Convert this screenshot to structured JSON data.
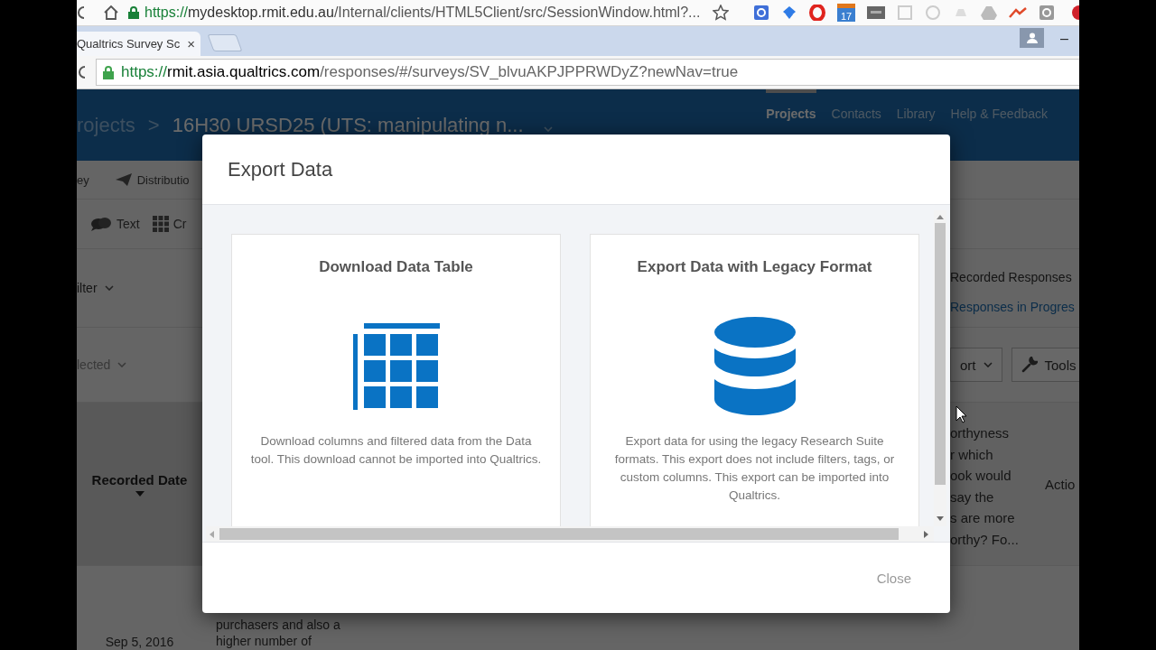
{
  "outer_browser": {
    "url_scheme": "https://",
    "url_host": "mydesktop.rmit.edu.au",
    "url_path": "/Internal/clients/HTML5Client/src/SessionWindow.html?...",
    "calendar_badge": "17"
  },
  "inner_browser": {
    "tab": {
      "title": "Qualtrics Survey Sc",
      "close": "×"
    },
    "minimize": "–",
    "url_scheme": "https://",
    "url_host": "rmit.asia.qualtrics.com",
    "url_path": "/responses/#/surveys/SV_blvuAKPJPPRWDyZ?newNav=true"
  },
  "header": {
    "breadcrumb_root": "rojects",
    "separator": ">",
    "project_title": "16H30 URSD25 (UTS: manipulating n...",
    "nav": [
      {
        "label": "Projects",
        "selected": true
      },
      {
        "label": "Contacts",
        "selected": false
      },
      {
        "label": "Library",
        "selected": false
      },
      {
        "label": "Help & Feedback",
        "selected": false
      }
    ]
  },
  "toolbar": [
    {
      "label": "ey",
      "kind": "plain"
    },
    {
      "label": "Distributio",
      "kind": "plane"
    }
  ],
  "tools": [
    {
      "label": "Text",
      "kind": "chat"
    },
    {
      "label": "Cr",
      "kind": "grid"
    }
  ],
  "filter": "ilter",
  "selection": "lected",
  "summary": [
    {
      "label": "Recorded Responses",
      "kind": "count"
    },
    {
      "label": "Responses in Progres",
      "kind": "link"
    }
  ],
  "actions": [
    {
      "label": "ort",
      "kind": "dropdown"
    },
    {
      "label": "Tools",
      "kind": "wrench"
    }
  ],
  "table": {
    "columns": [
      {
        "label": "Recorded Date",
        "sorted": true
      },
      {
        "lines": [
          "orthyness",
          "r which",
          "ook would",
          "say the",
          "s are more",
          "orthy? Fo..."
        ]
      },
      {
        "label": "Actio"
      }
    ],
    "rows": [
      {
        "date": "Sep 5, 2016",
        "text_lines": [
          "purchasers and also a",
          "higher number of"
        ]
      }
    ]
  },
  "modal": {
    "title": "Export Data",
    "options": [
      {
        "kind": "table",
        "title": "Download Data Table",
        "description": "Download columns and filtered data from the Data tool. This download cannot be imported into Qualtrics."
      },
      {
        "kind": "database",
        "title": "Export Data with Legacy Format",
        "description": "Export data for using the legacy Research Suite formats. This export does not include filters, tags, or custom columns. This export can be imported into Qualtrics."
      }
    ],
    "close": "Close"
  }
}
